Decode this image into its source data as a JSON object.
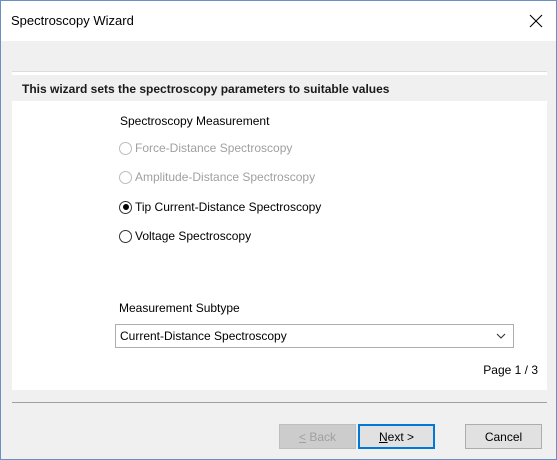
{
  "window": {
    "title": "Spectroscopy Wizard",
    "close_icon": "close-icon"
  },
  "header": {
    "text": "This wizard sets the spectroscopy parameters to suitable values"
  },
  "measurement": {
    "label": "Spectroscopy Measurement",
    "options": [
      {
        "label": "Force-Distance Spectroscopy",
        "enabled": false,
        "selected": false
      },
      {
        "label": "Amplitude-Distance Spectroscopy",
        "enabled": false,
        "selected": false
      },
      {
        "label": "Tip Current-Distance Spectroscopy",
        "enabled": true,
        "selected": true
      },
      {
        "label": "Voltage Spectroscopy",
        "enabled": true,
        "selected": false
      }
    ]
  },
  "subtype": {
    "label": "Measurement Subtype",
    "selected_value": "Current-Distance Spectroscopy"
  },
  "page_indicator": "Page 1 / 3",
  "buttons": {
    "back": {
      "label": "< Back",
      "enabled": false
    },
    "next": {
      "label": "Next >",
      "enabled": true
    },
    "cancel": {
      "label": "Cancel",
      "enabled": true
    }
  },
  "colors": {
    "accent": "#0078d7",
    "window_border": "#6a8fc4",
    "dialog_bg": "#f0f0f0",
    "disabled_text": "#a0a0a0"
  }
}
